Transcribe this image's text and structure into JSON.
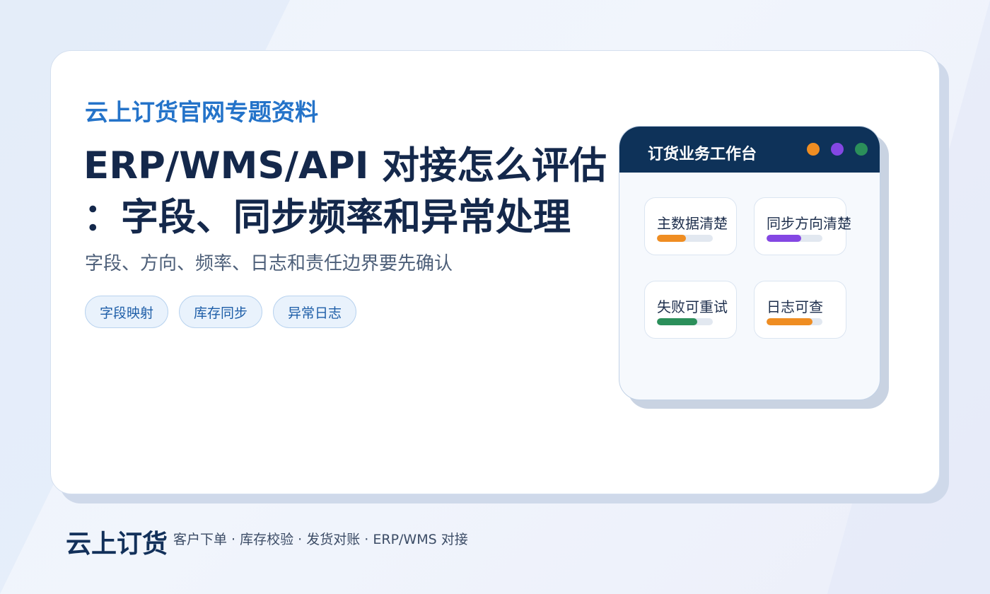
{
  "kicker": "云上订货官网专题资料",
  "title": {
    "line1": "ERP/WMS/API 对接怎么评估",
    "line2": "：字段、同步频率和异常处理"
  },
  "subtitle": "字段、方向、频率、日志和责任边界要先确认",
  "tags": [
    "字段映射",
    "库存同步",
    "异常日志"
  ],
  "panel": {
    "title": "订货业务工作台",
    "dots": [
      "#ef8d22",
      "#8447e3",
      "#2b8f5a"
    ],
    "metrics": [
      {
        "label": "主数据清楚",
        "progress": 0.52,
        "color": "#ef8d22"
      },
      {
        "label": "同步方向清楚",
        "progress": 0.62,
        "color": "#8447e3"
      },
      {
        "label": "失败可重试",
        "progress": 0.72,
        "color": "#2b8f5a"
      },
      {
        "label": "日志可查",
        "progress": 0.82,
        "color": "#ef8d22"
      }
    ]
  },
  "footer": {
    "brand": "云上订货",
    "tagline": "客户下单 · 库存校验 · 发货对账 · ERP/WMS 对接"
  }
}
